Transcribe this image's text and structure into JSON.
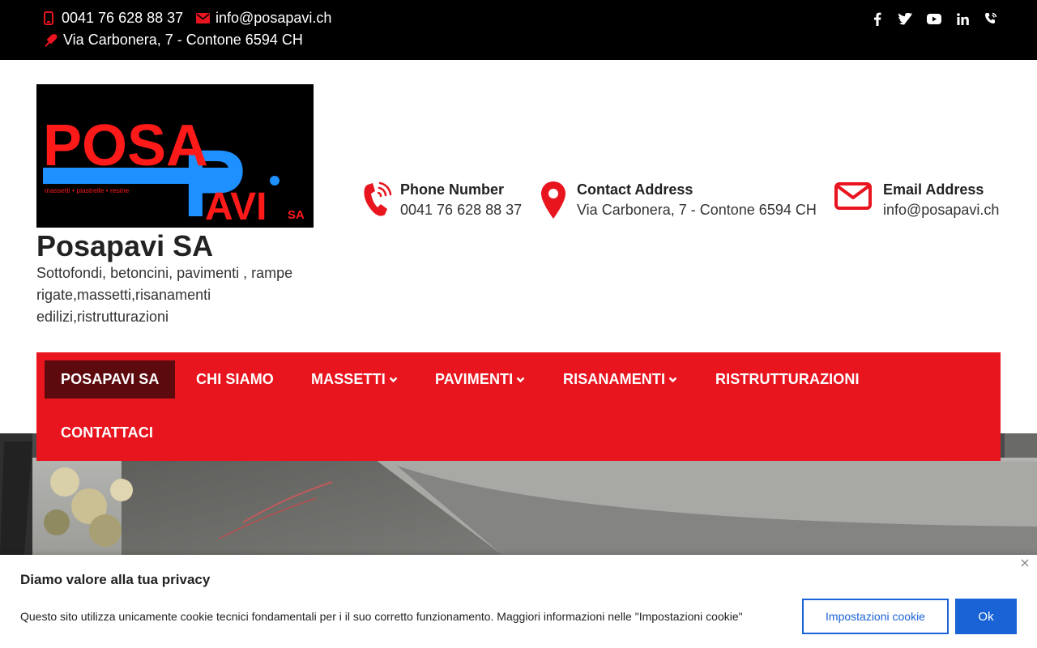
{
  "topbar": {
    "phone": "0041 76 628 88 37",
    "email": "info@posapavi.ch",
    "address": "Via Carbonera, 7 - Contone 6594 CH",
    "social": [
      "facebook-icon",
      "twitter-icon",
      "youtube-icon",
      "linkedin-icon",
      "phone-call-icon"
    ]
  },
  "header": {
    "logo": {
      "word1": "POSA",
      "word2": "AVI",
      "letter_p": "P",
      "tagline": "massetti • piastrelle • resine",
      "suffix": "SA"
    },
    "title": "Posapavi SA",
    "description": "Sottofondi, betoncini, pavimenti , rampe rigate,massetti,risanamenti edilizi,ristrutturazioni",
    "info": [
      {
        "label": "Phone Number",
        "value": "0041 76 628 88 37",
        "icon": "phone-icon"
      },
      {
        "label": "Contact Address",
        "value": "Via Carbonera, 7 - Contone 6594 CH",
        "icon": "location-pin-icon"
      },
      {
        "label": "Email Address",
        "value": "info@posapavi.ch",
        "icon": "envelope-icon"
      }
    ]
  },
  "nav": {
    "items": [
      {
        "label": "POSAPAVI SA",
        "active": true,
        "dropdown": false
      },
      {
        "label": "CHI SIAMO",
        "active": false,
        "dropdown": false
      },
      {
        "label": "MASSETTI",
        "active": false,
        "dropdown": true
      },
      {
        "label": "PAVIMENTI",
        "active": false,
        "dropdown": true
      },
      {
        "label": "RISANAMENTI",
        "active": false,
        "dropdown": true
      },
      {
        "label": "RISTRUTTURAZIONI",
        "active": false,
        "dropdown": false
      },
      {
        "label": "CONTATTACI",
        "active": false,
        "dropdown": false
      }
    ]
  },
  "cookie": {
    "title": "Diamo valore alla tua privacy",
    "text": "Questo sito utilizza unicamente cookie tecnici fondamentali per i il suo corretto funzionamento. Maggiori informazioni nelle \"Impostazioni cookie\"",
    "settings_label": "Impostazioni cookie",
    "ok_label": "Ok"
  },
  "colors": {
    "accent": "#e8141e",
    "active_nav": "#5c0a0e",
    "button_blue": "#1a63d6",
    "logo_blue": "#1e90ff"
  }
}
